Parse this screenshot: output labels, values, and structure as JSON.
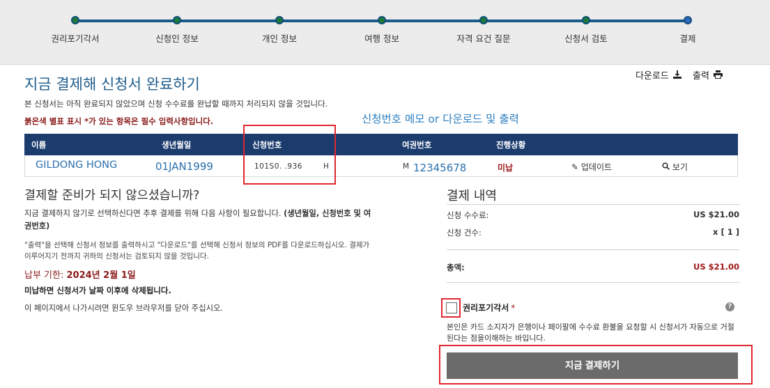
{
  "progress": {
    "steps": [
      {
        "label": "권리포기각서"
      },
      {
        "label": "신청인 정보"
      },
      {
        "label": "개인 정보"
      },
      {
        "label": "여행 정보"
      },
      {
        "label": "자격 요건 질문"
      },
      {
        "label": "신청서 검토"
      },
      {
        "label": "결제"
      }
    ]
  },
  "header": {
    "title": "지금 결제해 신청서 완료하기",
    "subtitle": "본 신청서는 아직 완료되지 않았으며 신청 수수료를 완납할 때까지 처리되지 않을 것입니다.",
    "required_note": "붉은색 별표 표시 *가 있는 항목은 필수 입력사항입니다.",
    "memo_hint": "신청번호 메모 or 다운로드 및 출력",
    "download_label": "다운로드",
    "print_label": "출력"
  },
  "table": {
    "headers": {
      "name": "이름",
      "dob": "생년월일",
      "app_no": "신청번호",
      "passport": "여권번호",
      "status": "진행상황"
    },
    "row": {
      "name": "GILDONG HONG",
      "dob": "01JAN1999",
      "app_no": "101S0.  .936",
      "app_no_suffix": "H",
      "passport_prefix": "M",
      "passport": "12345678",
      "status": "미납",
      "update_label": "업데이트",
      "view_label": "보기"
    }
  },
  "left": {
    "heading": "결제할 준비가 되지 않으셨습니까?",
    "p1_normal": "지금 결제하지 않기로 선택하신다면 추후 결제를 위해 다음 사항이 필요합니다. ",
    "p1_bold": "(생년월일, 신청번호 및 여권번호)",
    "p2": "\"출력\"을 선택해 신청서 정보를 출력하시고 \"다운로드\"를 선택해 신청서 정보의 PDF를 다운로드하십시오. 결제가 이루어지기 전까지 귀하의 신청서는 검토되지 않을 것입니다.",
    "due_prefix": "납부 기한: ",
    "due_date": "2024년 2월 1일",
    "delete_note": "미납하면 신청서가 날짜 이후에 삭제됩니다.",
    "close_note": "이 페이지에서 나가시려면 윈도우 브라우저를 닫아 주십시오."
  },
  "payment": {
    "title": "결제 내역",
    "fee_label": "신청 수수료:",
    "fee_value": "US $21.00",
    "count_label": "신청 건수:",
    "count_value": "x [ 1 ]",
    "total_label": "총액:",
    "total_value": "US $21.00",
    "waiver_label": "권리포기각서",
    "waiver_required": "*",
    "waiver_text": "본인은 카드 소지자가 은행이나 페이팔에 수수료 환불을 요청할 시 신청서가 자동으로 거절된다는 점을이해하는 바입니다.",
    "pay_button": "지금 결제하기"
  },
  "colors": {
    "accent_blue": "#1f5d8c",
    "table_header": "#1c3c6e",
    "required_red": "#a01818",
    "highlight_red": "#e0262f",
    "button_gray": "#6b6b6b"
  }
}
